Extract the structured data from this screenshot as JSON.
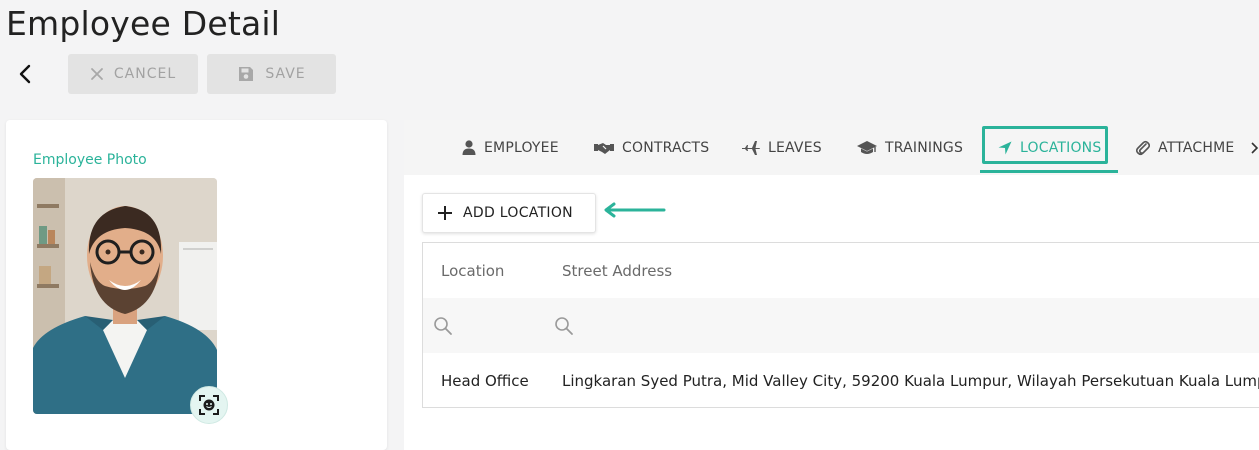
{
  "page": {
    "title": "Employee Detail"
  },
  "toolbar": {
    "cancel_label": "CANCEL",
    "save_label": "SAVE"
  },
  "photo": {
    "label": "Employee Photo"
  },
  "tabs": [
    {
      "label": "EMPLOYEE",
      "icon": "user-icon"
    },
    {
      "label": "CONTRACTS",
      "icon": "handshake-icon"
    },
    {
      "label": "LEAVES",
      "icon": "plane-icon"
    },
    {
      "label": "TRAININGS",
      "icon": "graduation-cap-icon"
    },
    {
      "label": "LOCATIONS",
      "icon": "location-arrow-icon",
      "active": true
    },
    {
      "label": "ATTACHME",
      "icon": "paperclip-icon"
    }
  ],
  "locations": {
    "add_label": "ADD LOCATION",
    "columns": [
      "Location",
      "Street Address"
    ],
    "rows": [
      {
        "location": "Head Office",
        "street_address": "Lingkaran Syed Putra, Mid Valley City, 59200 Kuala Lumpur, Wilayah Persekutuan Kuala Lumpu"
      }
    ]
  },
  "colors": {
    "accent": "#2bb39a",
    "disabled_bg": "#e3e3e3",
    "disabled_text": "#a2a2a2"
  }
}
